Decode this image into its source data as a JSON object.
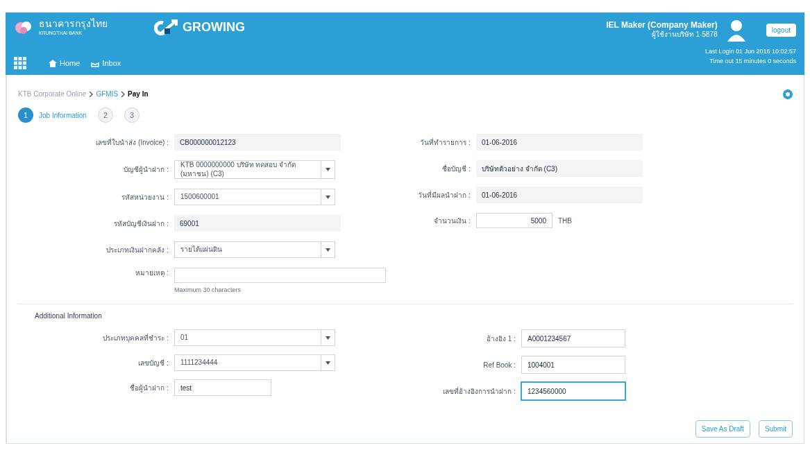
{
  "header": {
    "bank_name": "ธนาคารกรุงไทย",
    "bank_subtitle": "KRUNGTHAI BANK",
    "product": "GROWING",
    "nav": [
      {
        "label": "Home"
      },
      {
        "label": "Inbox"
      }
    ],
    "user": {
      "name": "IEL Maker (Company Maker)",
      "company": "ผู้ใช้งานบริษัท 1-5878",
      "last_login": "Last Login 01 Jun 2016 10:02:57",
      "timeout": "Time out 15 minutes 0 seconds"
    },
    "logout": "logout"
  },
  "breadcrumb": [
    {
      "label": "KTB Corporate Online",
      "link": false
    },
    {
      "label": "GFMIS",
      "link": true
    },
    {
      "label": "Pay In",
      "link": false
    }
  ],
  "steps": [
    {
      "number": "1",
      "label": "Job Information",
      "selected": true
    },
    {
      "number": "2",
      "selected": false
    },
    {
      "number": "3",
      "selected": false
    }
  ],
  "main_left": [
    {
      "label": "เลขที่ใบนำส่ง (Invoice) :",
      "kind": "readonly",
      "value": "CB000000012123"
    },
    {
      "label": "บัญชีผู้นำฝาก :",
      "kind": "select",
      "value": "KTB 0000000000 บริษัท ทดสอบ จำกัด (มหาชน) (C3)"
    },
    {
      "label": "รหัสหน่วยงาน :",
      "kind": "select",
      "value": "1500600001"
    },
    {
      "label": "รหัสบัญชีเงินฝาก :",
      "kind": "readonly",
      "value": "69001"
    },
    {
      "label": "ประเภทเงินฝากคลัง :",
      "kind": "select",
      "value": "รายได้แผ่นดิน"
    },
    {
      "label": "หมายเหตุ :",
      "kind": "wide",
      "help": "Maximum 30 characters"
    }
  ],
  "main_right": [
    {
      "label": "วันที่ทำรายการ :",
      "kind": "readonly",
      "value": "01-06-2016"
    },
    {
      "label": "ชื่อบัญชี :",
      "kind": "readonly",
      "value": "บริษัทตัวอย่าง จำกัด (C3)"
    },
    {
      "label": "วันที่มีผลนำฝาก :",
      "kind": "readonly",
      "value": "01-06-2016"
    },
    {
      "label": "จำนวนเงิน :",
      "kind": "amount",
      "value": "5000",
      "unit": "THB"
    }
  ],
  "additional": {
    "title": "Additional Information",
    "left": [
      {
        "label": "ประเภทบุคคลที่ชำระ :",
        "kind": "select",
        "value": "01"
      },
      {
        "label": "เลขบัญชี :",
        "kind": "select",
        "value": "1111234444"
      },
      {
        "label": "ชื่อผู้นำฝาก :",
        "kind": "short",
        "value": "test"
      }
    ],
    "right": [
      {
        "label": "อ้างอิง 1 :",
        "value": "A0001234567",
        "focused": false
      },
      {
        "label": "Ref Book :",
        "value": "1004001",
        "focused": false
      },
      {
        "label": "เลขที่อ้างอิงการนำฝาก :",
        "value": "1234560000",
        "focused": true
      }
    ]
  },
  "buttons": [
    "Save As Draft",
    "Submit"
  ]
}
